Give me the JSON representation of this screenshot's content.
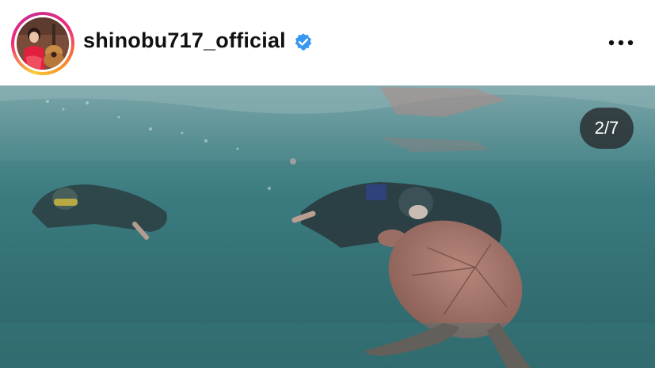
{
  "post": {
    "username": "shinobu717_official",
    "verified": true,
    "avatar_icon": "user-avatar-with-guitar",
    "more_icon": "more-horizontal-icon",
    "carousel_counter": "2/7"
  },
  "colors": {
    "verified_badge": "#3897f0",
    "story_ring": [
      "#f9ce34",
      "#ee2a7b",
      "#c72f8f"
    ],
    "counter_bg": "#2a2e32"
  }
}
